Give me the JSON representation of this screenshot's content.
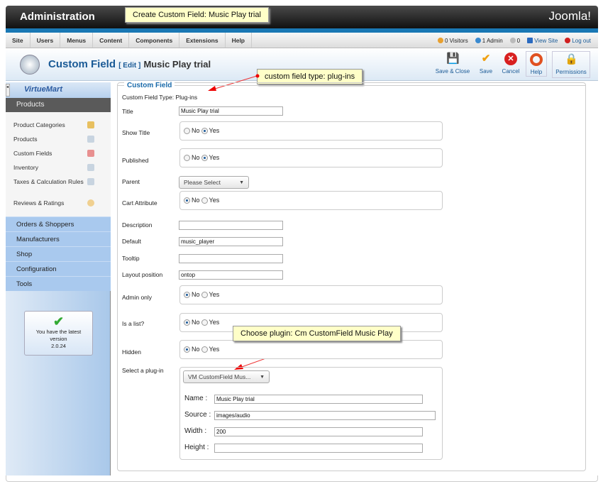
{
  "header": {
    "title": "Administration",
    "brand": "Joomla!"
  },
  "annotations": {
    "top": "Create Custom Field: Music Play trial",
    "type": "custom field type: plug-ins",
    "plugin": "Choose plugin: Cm CustomField Music Play",
    "color": "#ff0000"
  },
  "menu": [
    "Site",
    "Users",
    "Menus",
    "Content",
    "Components",
    "Extensions",
    "Help"
  ],
  "status": {
    "visitors": "0 Visitors",
    "admin": "1 Admin",
    "messages": "0",
    "view_site": "View Site",
    "logout": "Log out"
  },
  "toolbar": {
    "title": "Custom Field",
    "edit": "[ Edit ]",
    "subtitle": "Music Play trial",
    "save_close": "Save & Close",
    "save": "Save",
    "cancel": "Cancel",
    "help": "Help",
    "permissions": "Permissions"
  },
  "sidebar": {
    "logo": "VirtueMart",
    "section": "Products",
    "items": [
      "Product Categories",
      "Products",
      "Custom Fields",
      "Inventory",
      "Taxes & Calculation Rules",
      "Reviews & Ratings"
    ],
    "accordion": [
      "Orders & Shoppers",
      "Manufacturers",
      "Shop",
      "Configuration",
      "Tools"
    ],
    "version": {
      "msg": "You have the latest version",
      "number": "2.0.24"
    }
  },
  "form": {
    "legend": "Custom Field",
    "type_label": "Custom Field Type: Plug-ins",
    "title": {
      "label": "Title",
      "value": "Music Play trial"
    },
    "show_title": {
      "label": "Show Title",
      "value": "Yes"
    },
    "published": {
      "label": "Published",
      "value": "Yes"
    },
    "parent": {
      "label": "Parent",
      "value": "Please Select"
    },
    "cart_attribute": {
      "label": "Cart Attribute",
      "value": "No"
    },
    "description": {
      "label": "Description",
      "value": ""
    },
    "default": {
      "label": "Default",
      "value": "music_player"
    },
    "tooltip": {
      "label": "Tooltip",
      "value": ""
    },
    "layout_position": {
      "label": "Layout position",
      "value": "ontop"
    },
    "admin_only": {
      "label": "Admin only",
      "value": "No"
    },
    "is_list": {
      "label": "Is a list?",
      "value": "No"
    },
    "hidden": {
      "label": "Hidden",
      "value": "No"
    },
    "no": "No",
    "yes": "Yes",
    "plugin": {
      "label": "Select a plug-in",
      "value": "VM CustomField Mus...",
      "name": {
        "label": "Name :",
        "value": "Music Play trial"
      },
      "source": {
        "label": "Source :",
        "value": "images/audio"
      },
      "width": {
        "label": "Width :",
        "value": "200"
      },
      "height": {
        "label": "Height :",
        "value": ""
      }
    }
  }
}
